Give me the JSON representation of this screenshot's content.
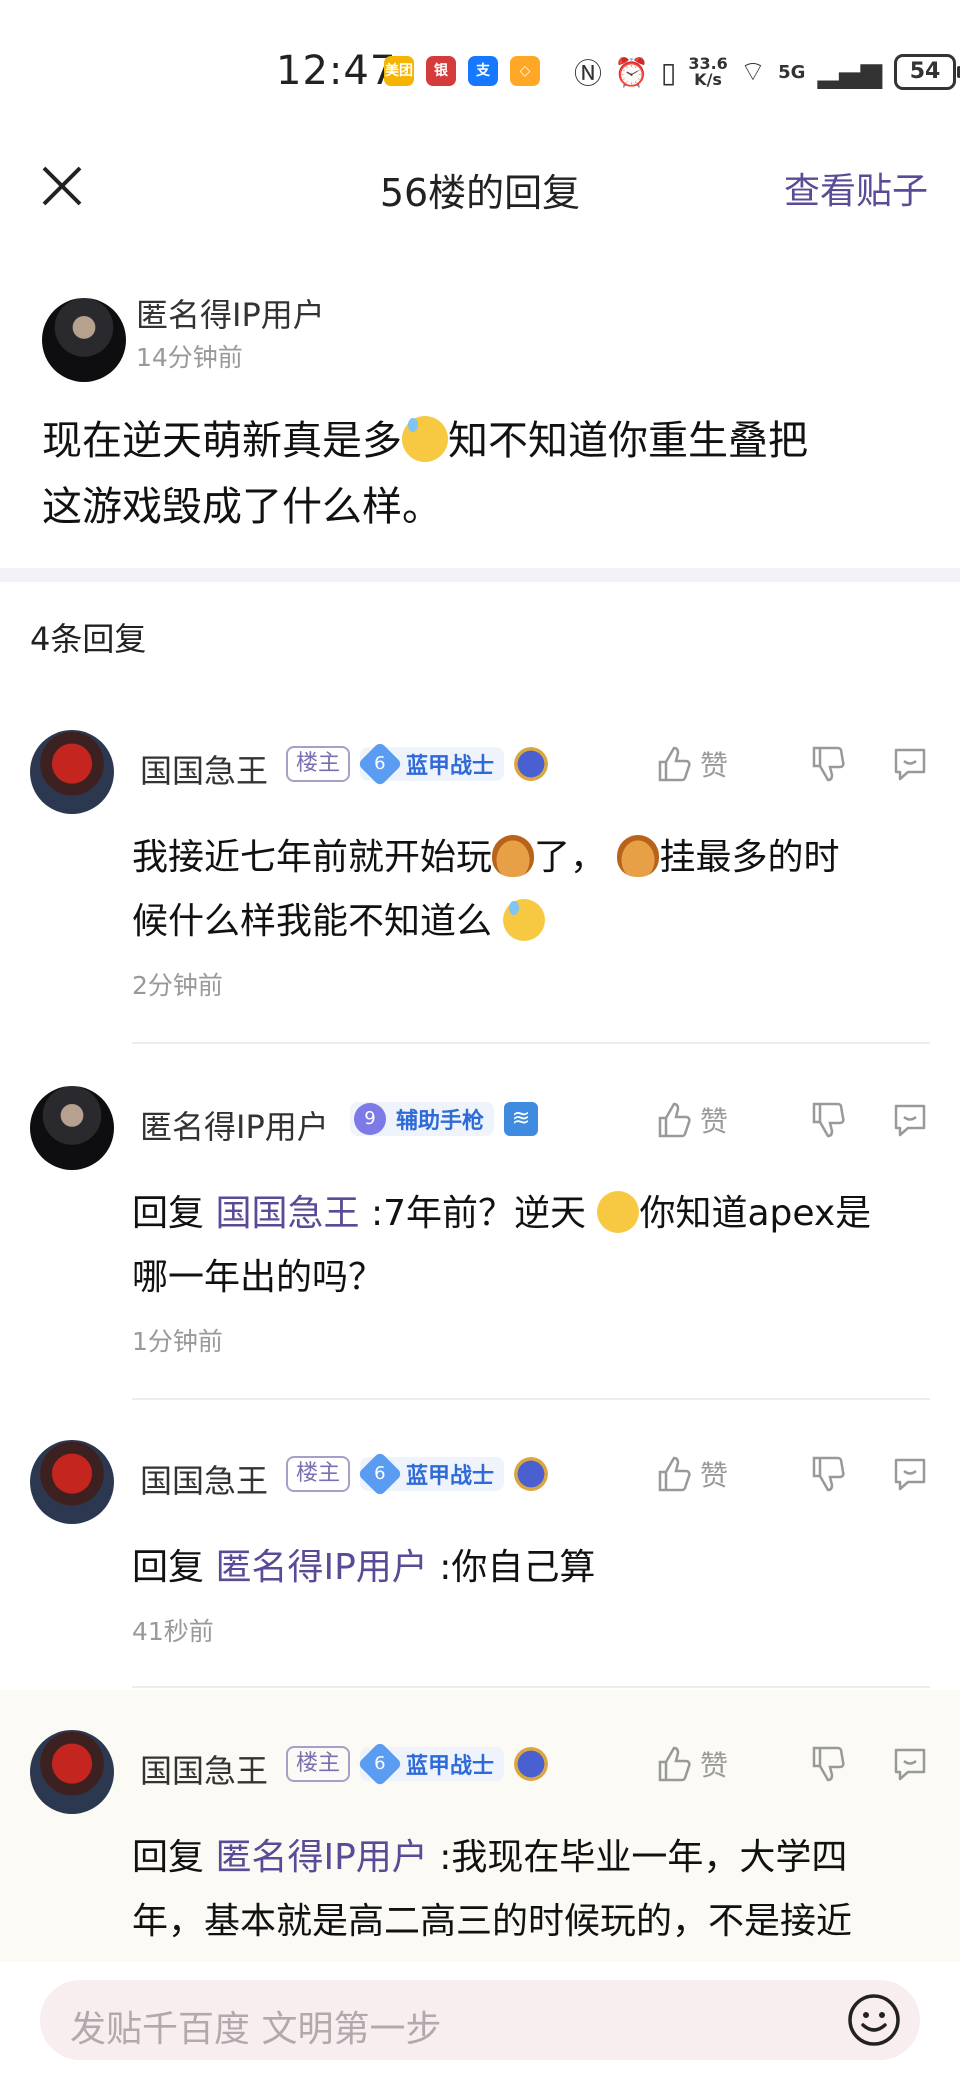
{
  "status_bar": {
    "time": "12:47",
    "apps": [
      {
        "name": "meituan",
        "label": "美团",
        "color": "#f5b400"
      },
      {
        "name": "bank",
        "label": "银",
        "color": "#d63b3b"
      },
      {
        "name": "alipay",
        "label": "支",
        "color": "#1677ff"
      },
      {
        "name": "app4",
        "label": "◇",
        "color": "#ffa726"
      }
    ],
    "net_speed": "33.6",
    "net_unit": "K/s",
    "signal": "5G",
    "battery": "54"
  },
  "header": {
    "title": "56楼的回复",
    "view_post": "查看贴子"
  },
  "original_post": {
    "author": "匿名得IP用户",
    "time": "14分钟前",
    "text_part1": "现在逆天萌新真是多",
    "text_part2": "知不知道你重生叠把",
    "text_line2": "这游戏毁成了什么样。"
  },
  "reply_count": "4条回复",
  "like_label": "赞",
  "replies": [
    {
      "author": "国国急王",
      "badge_owner": "楼主",
      "level": "6",
      "level_title": "蓝甲战士",
      "body_a": "我接近七年前就开始玩",
      "body_b": "了，",
      "body_c": "挂最多的时",
      "body_d": "候什么样我能不知道么",
      "time": "2分钟前"
    },
    {
      "author": "匿名得IP用户",
      "level": "9",
      "level_title": "辅助手枪",
      "reply_prefix": "回复",
      "reply_to": "国国急王",
      "body_a": ":7年前？逆天",
      "body_b": "你知道apex是",
      "body_c": "哪一年出的吗？",
      "time": "1分钟前"
    },
    {
      "author": "国国急王",
      "badge_owner": "楼主",
      "level": "6",
      "level_title": "蓝甲战士",
      "reply_prefix": "回复",
      "reply_to": "匿名得IP用户",
      "body_a": ":你自己算",
      "time": "41秒前"
    },
    {
      "author": "国国急王",
      "badge_owner": "楼主",
      "level": "6",
      "level_title": "蓝甲战士",
      "reply_prefix": "回复",
      "reply_to": "匿名得IP用户",
      "body_a": ":我现在毕业一年，大学四",
      "body_b": "年，基本就是高二高三的时候玩的，不是接近"
    }
  ],
  "bottom_bar": {
    "input_placeholder": "发贴千百度 文明第一步"
  }
}
